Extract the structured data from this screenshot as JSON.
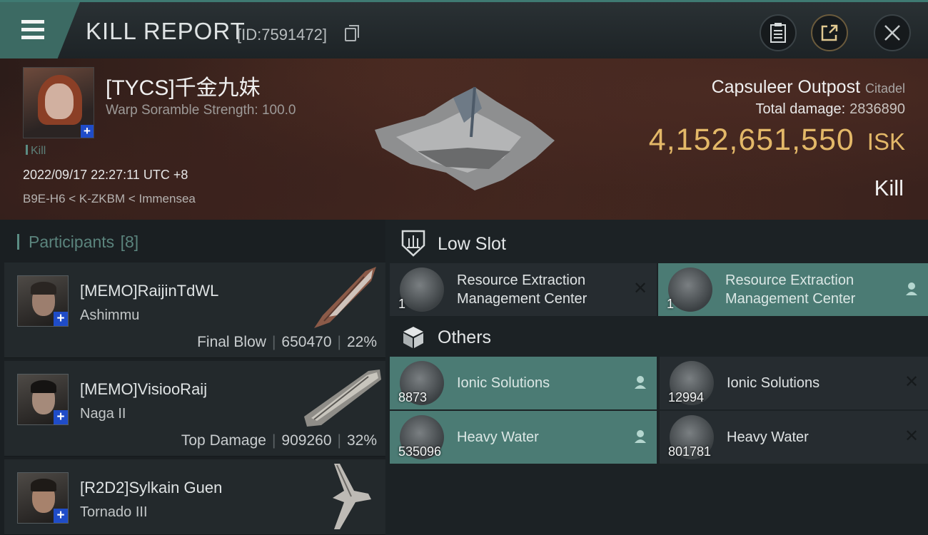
{
  "header": {
    "title": "KILL REPORT",
    "report_id": "[ID:7591472]"
  },
  "victim": {
    "name": "[TYCS]千金九妹",
    "scramble": "Warp Soramble Strength: 100.0",
    "kill_tag": "Kill",
    "datetime": "2022/09/17 22:27:11 UTC +8",
    "location": "B9E-H6 < K-ZKBM < Immensea"
  },
  "structure": {
    "name": "Capsuleer Outpost",
    "type": "Citadel",
    "total_damage_label": "Total damage:",
    "total_damage": "2836890",
    "isk_value": "4,152,651,550",
    "isk_unit": "ISK",
    "result": "Kill"
  },
  "participants": {
    "label": "Participants",
    "count": "[8]",
    "list": [
      {
        "name": "[MEMO]RaijinTdWL",
        "ship": "Ashimmu",
        "role": "Final Blow",
        "damage": "650470",
        "percent": "22%"
      },
      {
        "name": "[MEMO]VisiooRaij",
        "ship": "Naga II",
        "role": "Top Damage",
        "damage": "909260",
        "percent": "32%"
      },
      {
        "name": "[R2D2]Sylkain Guen",
        "ship": "Tornado III"
      }
    ]
  },
  "sections": {
    "low_slot": "Low Slot",
    "others": "Others"
  },
  "items": {
    "low": [
      {
        "line1": "Resource Extraction",
        "line2": "Management Center",
        "qty": "1",
        "status": "destroyed"
      },
      {
        "line1": "Resource Extraction",
        "line2": "Management Center",
        "qty": "1",
        "status": "dropped"
      }
    ],
    "others": [
      {
        "name": "Ionic Solutions",
        "qty": "8873",
        "status": "dropped"
      },
      {
        "name": "Ionic Solutions",
        "qty": "12994",
        "status": "destroyed"
      },
      {
        "name": "Heavy Water",
        "qty": "535096",
        "status": "dropped"
      },
      {
        "name": "Heavy Water",
        "qty": "801781",
        "status": "destroyed"
      }
    ]
  },
  "icons": {
    "menu": "hamburger-menu-icon",
    "copy": "copy-icon",
    "clipboard": "clipboard-icon",
    "share": "share-icon",
    "close": "close-icon",
    "low_slot": "low-slot-icon",
    "others": "cube-icon",
    "destroyed": "x-mark-icon",
    "dropped": "pilot-icon"
  },
  "colors": {
    "accent": "#3c6a63",
    "isk": "#e3b868",
    "dropped_bg": "#4b7b74"
  }
}
